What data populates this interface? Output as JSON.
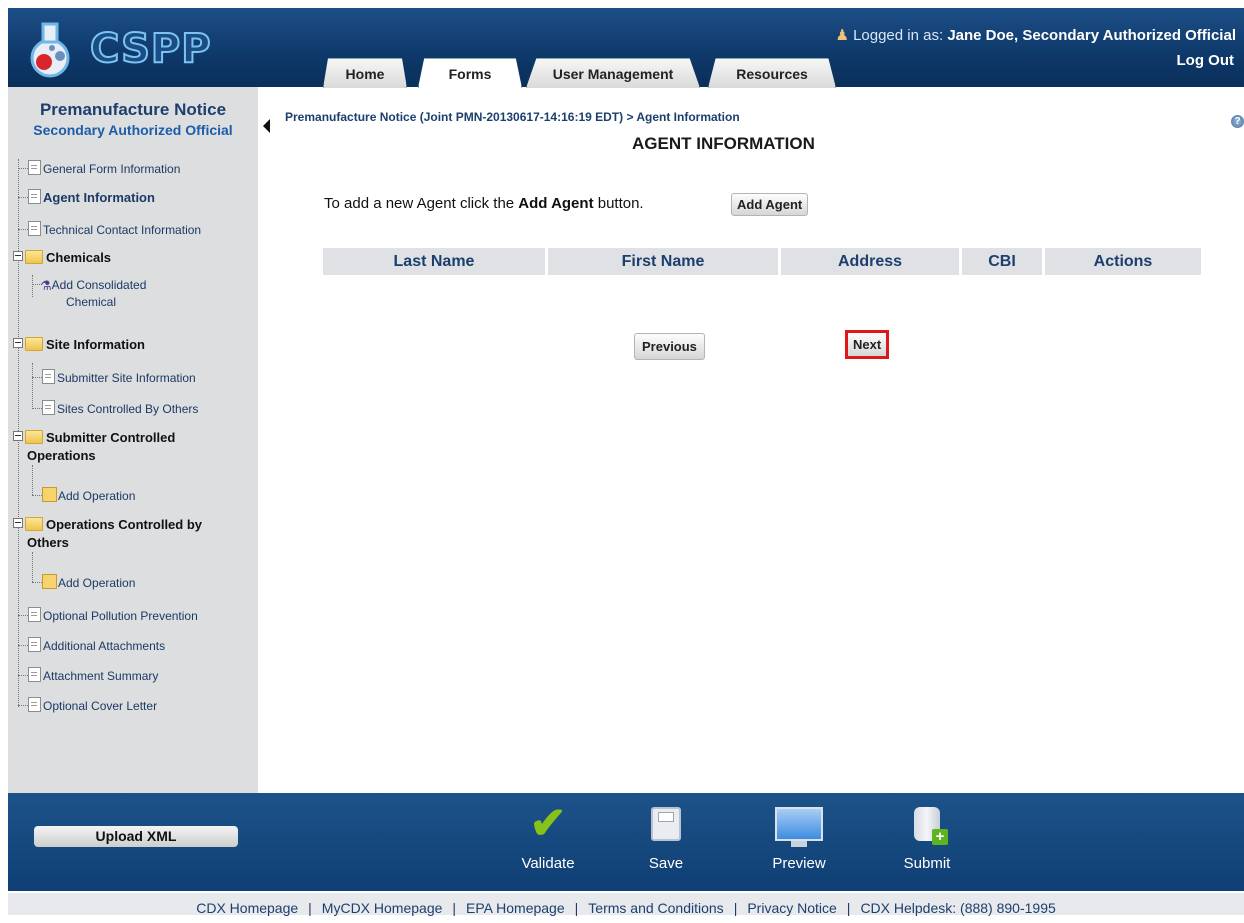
{
  "header": {
    "app_name": "CSPP",
    "logged_in_label": "Logged in as:",
    "user_name": "Jane Doe, Secondary Authorized Official",
    "logout_label": "Log Out",
    "tabs": [
      {
        "label": "Home"
      },
      {
        "label": "Forms"
      },
      {
        "label": "User Management"
      },
      {
        "label": "Resources"
      }
    ],
    "active_tab": "Forms"
  },
  "sidebar": {
    "title": "Premanufacture Notice",
    "subtitle": "Secondary Authorized Official",
    "items": [
      {
        "label": "General Form Information",
        "type": "doc"
      },
      {
        "label": "Agent Information",
        "type": "doc",
        "current": true
      },
      {
        "label": "Technical Contact Information",
        "type": "doc"
      },
      {
        "label": "Chemicals",
        "type": "folder"
      },
      {
        "label": "Add Consolidated",
        "label2": "Chemical",
        "type": "flask"
      },
      {
        "label": "Site Information",
        "type": "folder"
      },
      {
        "label": "Submitter Site Information",
        "type": "doc"
      },
      {
        "label": "Sites Controlled By Others",
        "type": "doc"
      },
      {
        "label": "Submitter Controlled",
        "label2": "Operations",
        "type": "folder"
      },
      {
        "label": "Add Operation",
        "type": "ops"
      },
      {
        "label": "Operations Controlled by",
        "label2": "Others",
        "type": "folder"
      },
      {
        "label": "Add Operation",
        "type": "ops"
      },
      {
        "label": "Optional Pollution Prevention",
        "type": "doc"
      },
      {
        "label": "Additional Attachments",
        "type": "doc"
      },
      {
        "label": "Attachment Summary",
        "type": "doc"
      },
      {
        "label": "Optional Cover Letter",
        "type": "doc"
      }
    ]
  },
  "main": {
    "breadcrumb": "Premanufacture Notice (Joint PMN-20130617-14:16:19 EDT) > Agent Information",
    "title": "AGENT INFORMATION",
    "instruction_pre": "To add a new Agent click the ",
    "instruction_bold": "Add Agent",
    "instruction_post": " button.",
    "add_agent_label": "Add Agent",
    "table_columns": [
      "Last Name",
      "First Name",
      "Address",
      "CBI",
      "Actions"
    ],
    "previous_label": "Previous",
    "next_label": "Next"
  },
  "footer": {
    "upload_label": "Upload XML",
    "actions": [
      {
        "label": "Validate",
        "icon": "checkmark-icon"
      },
      {
        "label": "Save",
        "icon": "floppy-disk-icon"
      },
      {
        "label": "Preview",
        "icon": "monitor-icon"
      },
      {
        "label": "Submit",
        "icon": "database-submit-icon"
      }
    ],
    "links": [
      {
        "label": "CDX Homepage"
      },
      {
        "label": "MyCDX Homepage"
      },
      {
        "label": "EPA Homepage"
      },
      {
        "label": "Terms and Conditions"
      },
      {
        "label": "Privacy Notice"
      },
      {
        "label": "CDX Helpdesk: (888) 890-1995"
      }
    ]
  },
  "colors": {
    "header_bg": "#0f3a6c",
    "sidebar_bg": "#dcdee0",
    "highlight_border": "#e0161c",
    "link_color": "#1c3f6e"
  }
}
